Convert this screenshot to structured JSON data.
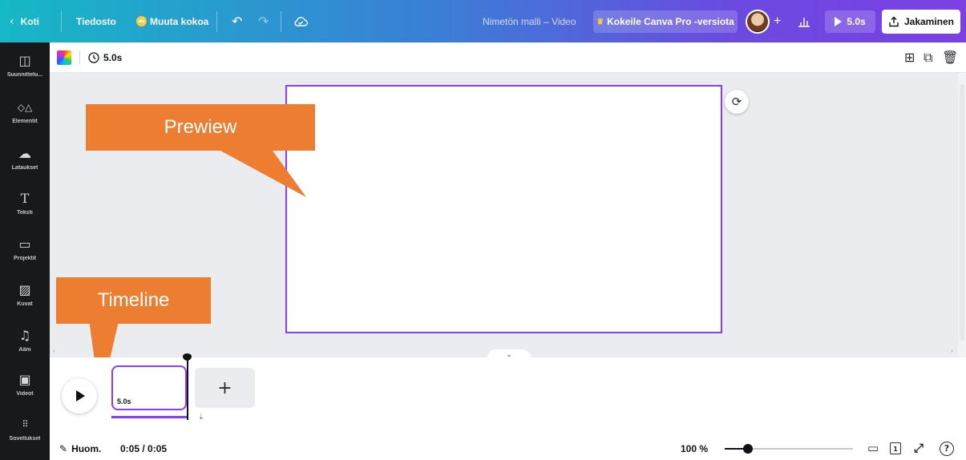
{
  "topbar": {
    "home_label": "Koti",
    "file_label": "Tiedosto",
    "resize_label": "Muuta kokoa",
    "design_title": "Nimetön malli – Video",
    "pro_label": "Kokeile Canva Pro -versiota",
    "play_duration": "5.0s",
    "share_label": "Jakaminen"
  },
  "sidebar": {
    "items": [
      {
        "label": "Suunnittelu...",
        "icon": "layout-icon"
      },
      {
        "label": "Elementit",
        "icon": "shapes-icon"
      },
      {
        "label": "Lataukset",
        "icon": "upload-cloud-icon"
      },
      {
        "label": "Teksti",
        "icon": "text-icon"
      },
      {
        "label": "Projektit",
        "icon": "folder-icon"
      },
      {
        "label": "Kuvat",
        "icon": "image-icon"
      },
      {
        "label": "Ääni",
        "icon": "music-icon"
      },
      {
        "label": "Videot",
        "icon": "video-icon"
      },
      {
        "label": "Sovellukset",
        "icon": "apps-icon"
      }
    ]
  },
  "toolbar": {
    "duration": "5.0s"
  },
  "callouts": {
    "preview": "Prewiew",
    "timeline": "Timeline",
    "color": "#ed7d31"
  },
  "timeline": {
    "clip_duration": "5.0s",
    "add_label": "+"
  },
  "bottombar": {
    "notes_label": "Huom.",
    "time": "0:05 / 0:05",
    "zoom": "100 %",
    "zoom_level": 0.18,
    "page_count": "1"
  },
  "colors": {
    "accent": "#8b3dff",
    "sidebar_bg": "#18191b"
  }
}
